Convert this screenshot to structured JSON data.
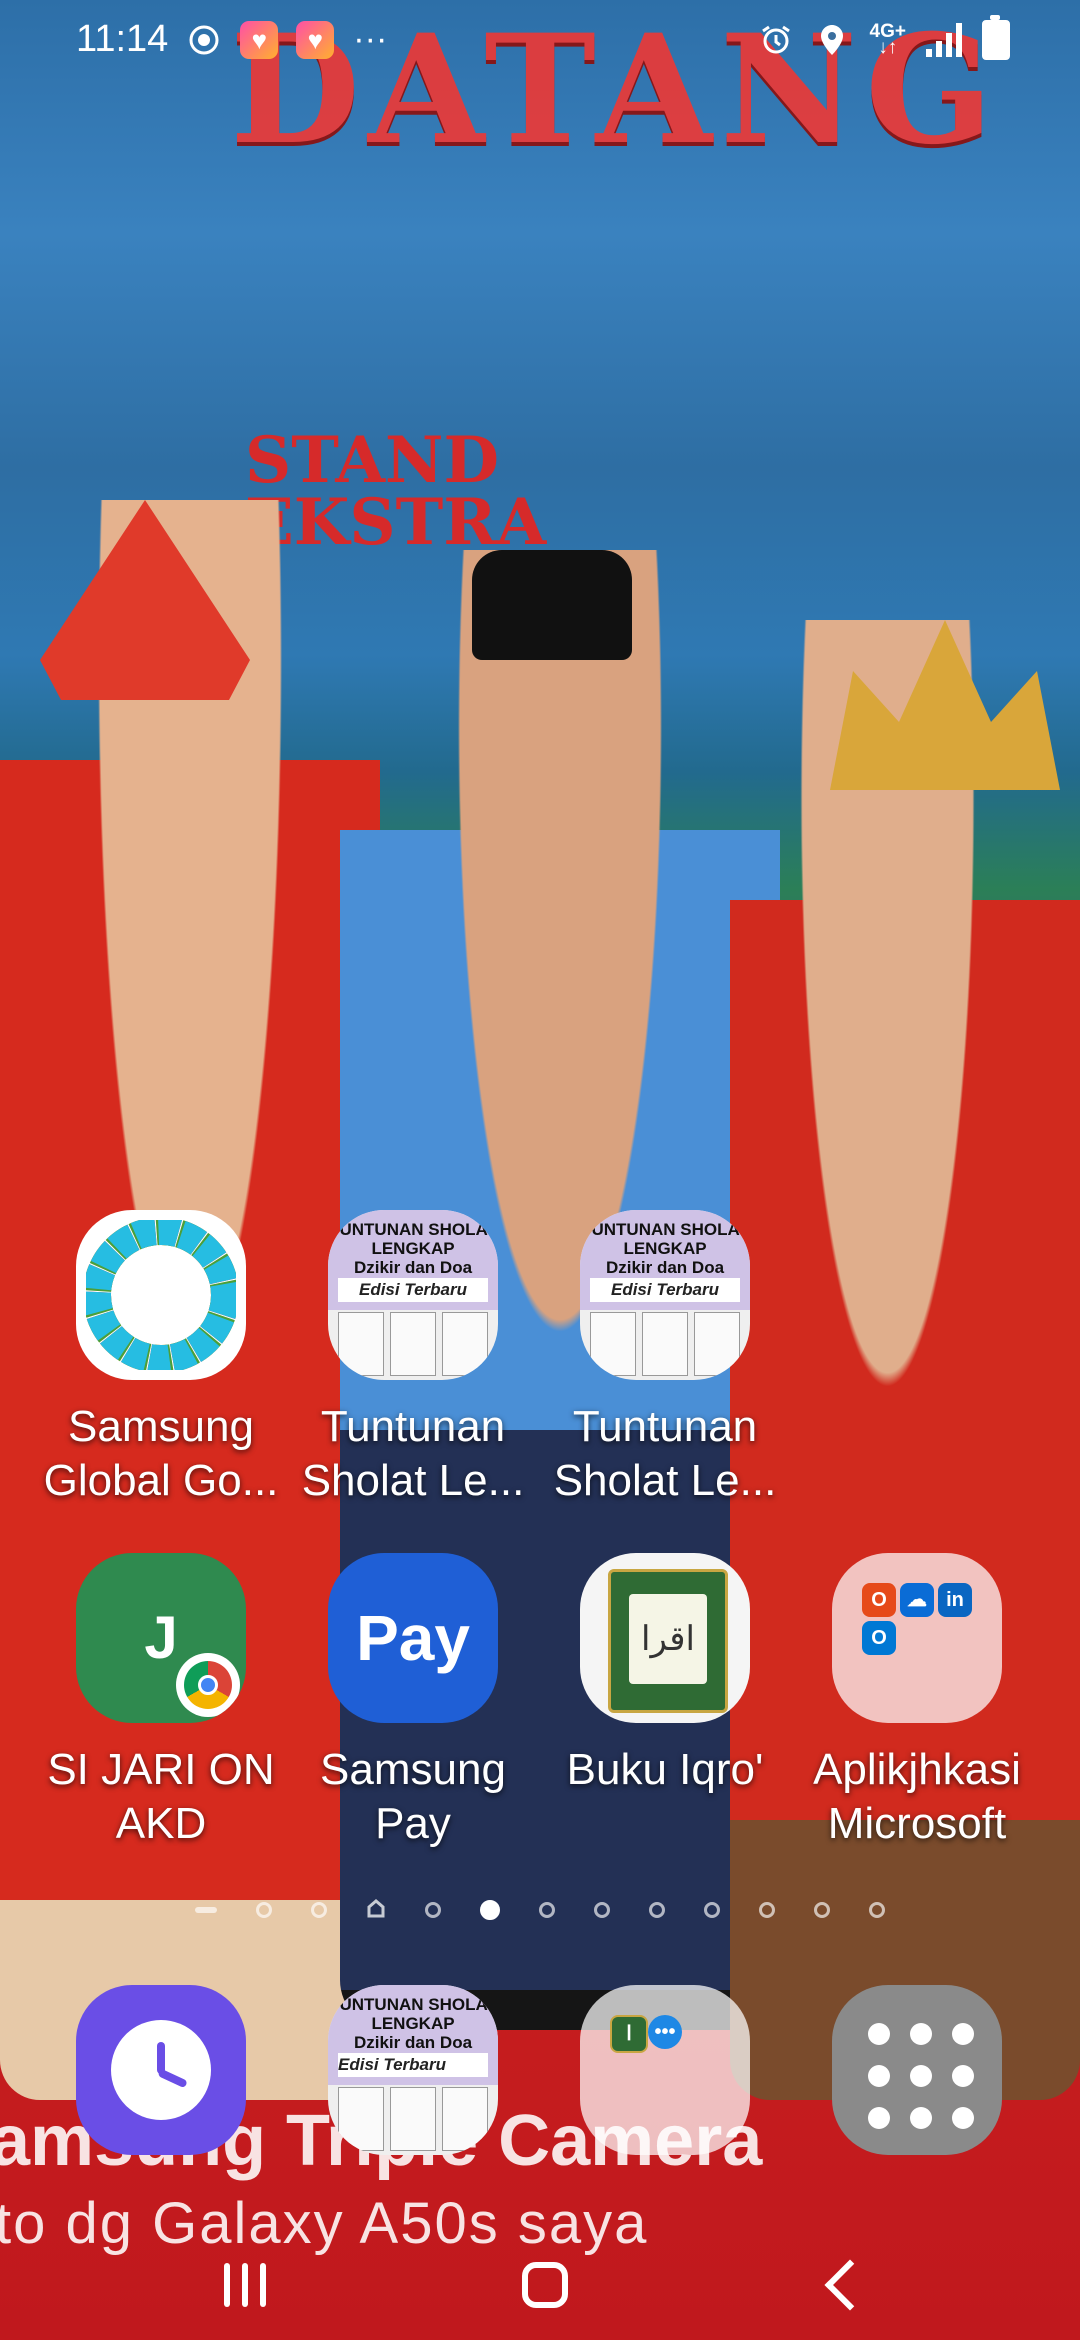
{
  "status_bar": {
    "time": "11:14",
    "network": "4G+",
    "icons": [
      "screen-recorder-icon",
      "heart-app-icon",
      "heart-app-icon",
      "more-notifications-icon",
      "alarm-icon",
      "location-icon",
      "lte-icon",
      "signal-icon",
      "battery-icon"
    ]
  },
  "wallpaper": {
    "banner_text": "DATANG",
    "sign_text": "STAND\nEKSTRA",
    "caption_line1": "amsung Triple Camera",
    "caption_line2": "to dg Galaxy A50s saya"
  },
  "apps": [
    {
      "label": "Samsung\nGlobal Go...",
      "icon": "sdg-wheel-icon"
    },
    {
      "label": "Tuntunan\nSholat Le...",
      "icon": "book-cover-icon"
    },
    {
      "label": "Tuntunan\nSholat Le...",
      "icon": "book-cover-icon"
    },
    {
      "label": "SI JARI ON\nAKD",
      "icon": "j-chrome-icon"
    },
    {
      "label": "Samsung\nPay",
      "icon": "samsung-pay-icon"
    },
    {
      "label": "Buku Iqro'",
      "icon": "iqro-book-icon"
    },
    {
      "label": "Aplikjhkasi\nMicrosoft",
      "icon": "microsoft-folder-icon"
    }
  ],
  "book_cover": {
    "line1": "TUNTUNAN SHOLAT",
    "line2": "LENGKAP",
    "line3": "Dzikir dan Doa",
    "edition": "Edisi Terbaru"
  },
  "iqro_symbol": "اقرا",
  "apps_mini": {
    "sijari_letter": "J",
    "pay_text": "Pay"
  },
  "page_indicator": {
    "pages": 12,
    "active_index": 5
  },
  "dock": [
    {
      "name": "clock",
      "icon": "clock-icon"
    },
    {
      "name": "tuntunan-sholat",
      "icon": "book-cover-icon"
    },
    {
      "name": "folder",
      "icon": "folder-icon"
    },
    {
      "name": "apps",
      "icon": "apps-grid-icon"
    }
  ],
  "nav": {
    "recents": "recents-icon",
    "home": "home-icon",
    "back": "back-icon"
  }
}
